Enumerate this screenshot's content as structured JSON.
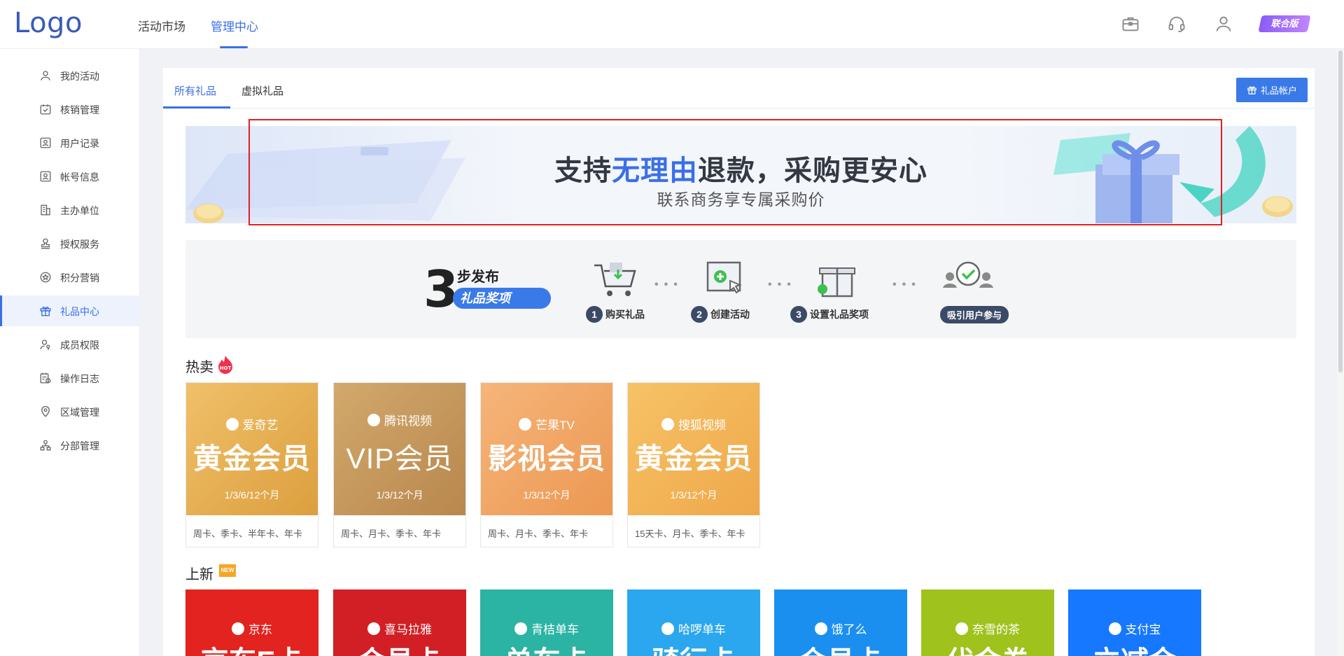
{
  "header": {
    "logo": "Logo",
    "nav": [
      {
        "label": "活动市场",
        "active": false
      },
      {
        "label": "管理中心",
        "active": true
      }
    ],
    "icons": [
      "briefcase-icon",
      "headset-icon",
      "user-icon"
    ],
    "version_label": "联合版"
  },
  "sidebar": {
    "items": [
      {
        "label": "我的活动",
        "icon": "user-icon",
        "active": false
      },
      {
        "label": "核销管理",
        "icon": "calendar-check-icon",
        "active": false
      },
      {
        "label": "用户记录",
        "icon": "contact-card-icon",
        "active": false
      },
      {
        "label": "帐号信息",
        "icon": "account-card-icon",
        "active": false
      },
      {
        "label": "主办单位",
        "icon": "building-icon",
        "active": false
      },
      {
        "label": "授权服务",
        "icon": "stamp-icon",
        "active": false
      },
      {
        "label": "积分营销",
        "icon": "star-circle-icon",
        "active": false
      },
      {
        "label": "礼品中心",
        "icon": "gift-icon",
        "active": true
      },
      {
        "label": "成员权限",
        "icon": "user-key-icon",
        "active": false
      },
      {
        "label": "操作日志",
        "icon": "log-icon",
        "active": false
      },
      {
        "label": "区域管理",
        "icon": "location-icon",
        "active": false
      },
      {
        "label": "分部管理",
        "icon": "org-chart-icon",
        "active": false
      }
    ]
  },
  "tabs": [
    {
      "label": "所有礼品",
      "active": true
    },
    {
      "label": "虚拟礼品",
      "active": false
    }
  ],
  "gift_account_button": "礼品帐户",
  "banner": {
    "title_pre": "支持",
    "title_highlight": "无理由",
    "title_post": "退款，采购更安心",
    "subtitle": "联系商务享专属采购价"
  },
  "steps": {
    "big_number": "3",
    "heading": "步发布",
    "pill": "礼品奖项",
    "items": [
      {
        "num": "1",
        "label": "购买礼品"
      },
      {
        "num": "2",
        "label": "创建活动"
      },
      {
        "num": "3",
        "label": "设置礼品奖项"
      },
      {
        "num": "",
        "label": "吸引用户参与"
      }
    ]
  },
  "hot": {
    "title": "热卖",
    "badge": "HOT",
    "cards": [
      {
        "brand": "爱奇艺",
        "main": "黄金会员",
        "period": "1/3/6/12个月",
        "desc": "周卡、季卡、半年卡、年卡",
        "color": "#e8ac4e"
      },
      {
        "brand": "腾讯视频",
        "main": "VIP会员",
        "period": "1/3/12个月",
        "desc": "周卡、月卡、季卡、年卡",
        "color": "#c69a5e"
      },
      {
        "brand": "芒果TV",
        "main": "影视会员",
        "period": "1/3/12个月",
        "desc": "周卡、月卡、季卡、年卡",
        "color": "#f0a060"
      },
      {
        "brand": "搜狐视频",
        "main": "黄金会员",
        "period": "1/3/12个月",
        "desc": "15天卡、月卡、季卡、年卡",
        "color": "#f2b25a"
      }
    ]
  },
  "new": {
    "title": "上新",
    "badge": "NEW",
    "cards": [
      {
        "brand": "京东",
        "main": "京东E卡",
        "color": "#e3231f"
      },
      {
        "brand": "喜马拉雅",
        "main": "会员卡",
        "color": "#d11f25"
      },
      {
        "brand": "青桔单车",
        "main": "单车卡",
        "color": "#2bb3a3"
      },
      {
        "brand": "哈啰单车",
        "main": "骑行卡",
        "color": "#2aa7ee"
      },
      {
        "brand": "饿了么",
        "main": "会员卡",
        "color": "#1a8ff0"
      },
      {
        "brand": "奈雪的茶",
        "main": "代金券",
        "color": "#9fc21c"
      },
      {
        "brand": "支付宝",
        "main": "立减金",
        "color": "#1677ff"
      }
    ]
  }
}
